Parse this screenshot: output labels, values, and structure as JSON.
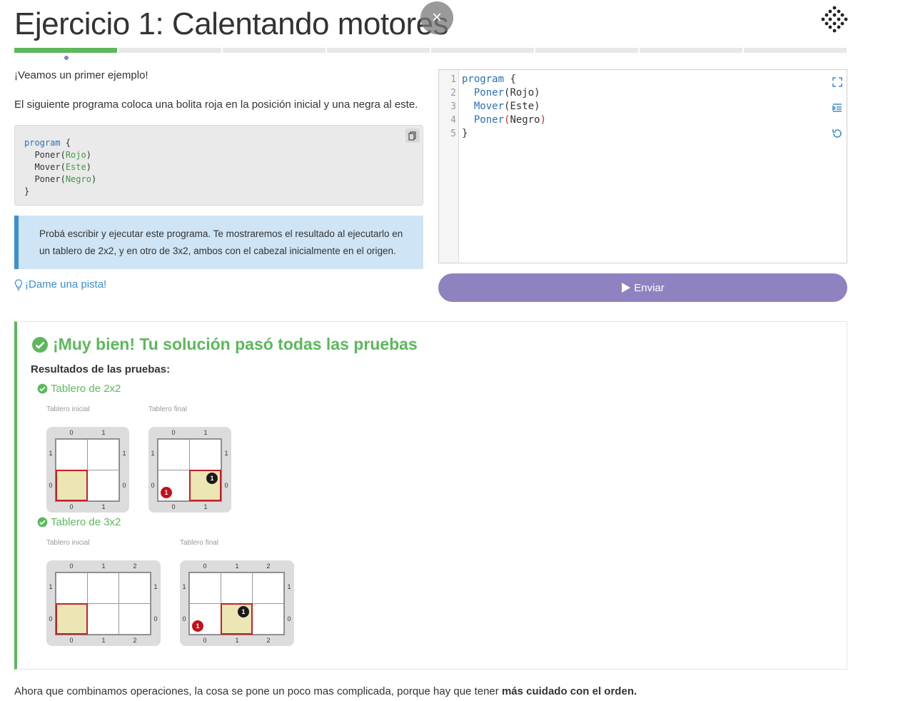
{
  "header": {
    "title": "Ejercicio 1: Calentando motores",
    "close_label": "×"
  },
  "progress": {
    "total_steps": 8,
    "completed_steps": 1
  },
  "lesson": {
    "intro": "¡Veamos un primer ejemplo!",
    "description": "El siguiente programa coloca una bolita roja en la posición inicial y una negra al este.",
    "example_code": {
      "line1_kw": "program",
      "line1_rest": " {",
      "line2_fn": "Poner",
      "line2_arg": "Rojo",
      "line3_fn": "Mover",
      "line3_arg": "Este",
      "line4_fn": "Poner",
      "line4_arg": "Negro",
      "line5": "}"
    },
    "info": "Probá escribir y ejecutar este programa. Te mostraremos el resultado al ejecutarlo en un tablero de 2x2, y en otro de 3x2, ambos con el cabezal inicialmente en el origen.",
    "hint_label": "¡Dame una pista!"
  },
  "editor": {
    "line_numbers": [
      "1",
      "2",
      "3",
      "4",
      "5"
    ],
    "lines": {
      "l1_kw": "program",
      "l1_rest": " {",
      "l2_kw": "Poner",
      "l2_rest": "(Rojo)",
      "l3_kw": "Mover",
      "l3_rest": "(Este)",
      "l4_kw": "Poner",
      "l4_open": "(",
      "l4_arg": "Negro",
      "l4_close": ")",
      "l5": "}"
    },
    "submit_label": "Enviar"
  },
  "result": {
    "title": "¡Muy bien! Tu solución pasó todas las pruebas",
    "results_label": "Resultados de las pruebas:",
    "tests": [
      {
        "title": "Tablero de 2x2",
        "initial_label": "Tablero inicial",
        "final_label": "Tablero final"
      },
      {
        "title": "Tablero de 3x2",
        "initial_label": "Tablero inicial",
        "final_label": "Tablero final"
      }
    ],
    "ball_count": "1"
  },
  "footer": {
    "text": "Ahora que combinamos operaciones, la cosa se pone un poco mas complicada, porque hay que tener ",
    "bold": "más cuidado con el orden."
  },
  "colors": {
    "success": "#5cb85c",
    "accent": "#8e82c0",
    "info_border": "#3d8fd1",
    "head": "#c0222a"
  }
}
